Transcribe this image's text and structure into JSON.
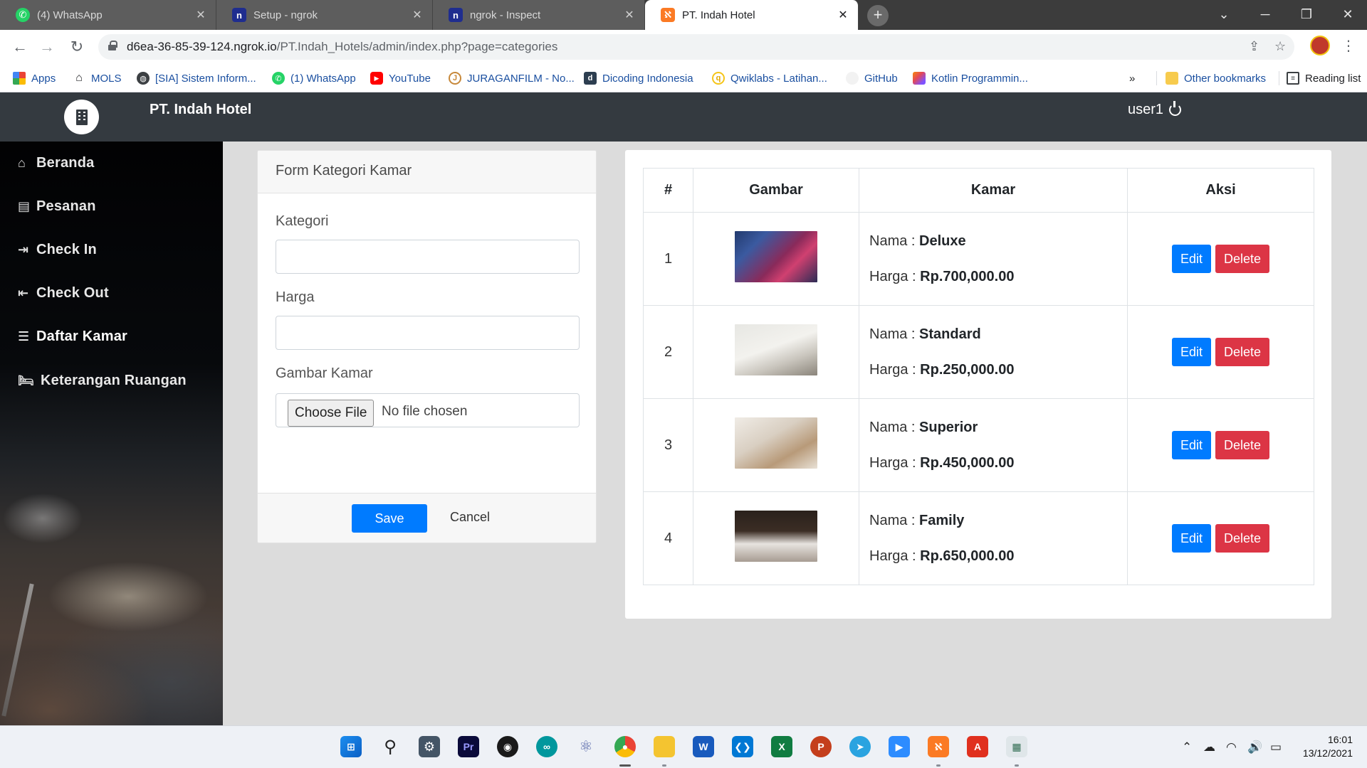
{
  "browser": {
    "tabs": [
      {
        "title": "(4) WhatsApp",
        "favicon": "whatsapp-icon",
        "color": "#25d366"
      },
      {
        "title": "Setup - ngrok",
        "favicon": "ngrok-icon",
        "color": "#1f2d8f"
      },
      {
        "title": "ngrok - Inspect",
        "favicon": "ngrok-icon",
        "color": "#1f2d8f"
      },
      {
        "title": "PT. Indah Hotel",
        "favicon": "xampp-icon",
        "color": "#fb7a24",
        "active": true
      }
    ],
    "url_host": "d6ea-36-85-39-124.ngrok.io",
    "url_path": "/PT.Indah_Hotels/admin/index.php?page=categories",
    "bookmarks": [
      {
        "label": "Apps",
        "icon": "apps-grid-icon"
      },
      {
        "label": "MOLS",
        "icon": "home-icon"
      },
      {
        "label": "[SIA] Sistem Inform...",
        "icon": "globe-icon"
      },
      {
        "label": "(1) WhatsApp",
        "icon": "whatsapp-icon"
      },
      {
        "label": "YouTube",
        "icon": "youtube-icon"
      },
      {
        "label": "JURAGANFILM - No...",
        "icon": "juraganfilm-icon"
      },
      {
        "label": "Dicoding Indonesia",
        "icon": "dicoding-icon"
      },
      {
        "label": "Qwiklabs - Latihan...",
        "icon": "qwiklabs-icon"
      },
      {
        "label": "GitHub",
        "icon": "github-icon"
      },
      {
        "label": "Kotlin Programmin...",
        "icon": "kotlin-icon"
      }
    ],
    "more": "»",
    "other_bookmarks": "Other bookmarks",
    "reading_list": "Reading list"
  },
  "header": {
    "brand": "PT. Indah Hotel",
    "user": "user1"
  },
  "sidebar": {
    "items": [
      {
        "label": "Beranda",
        "icon": "home-icon"
      },
      {
        "label": "Pesanan",
        "icon": "order-icon"
      },
      {
        "label": "Check In",
        "icon": "sign-in-icon"
      },
      {
        "label": "Check Out",
        "icon": "sign-out-icon"
      },
      {
        "label": "Daftar Kamar",
        "icon": "list-icon",
        "active": true
      },
      {
        "label": "Keterangan Ruangan",
        "icon": "bed-icon"
      }
    ]
  },
  "form": {
    "title": "Form Kategori Kamar",
    "kategori_label": "Kategori",
    "kategori_value": "",
    "harga_label": "Harga",
    "harga_value": "",
    "gambar_label": "Gambar Kamar",
    "file_button": "Choose File",
    "file_status": "No file chosen",
    "save": "Save",
    "cancel": "Cancel"
  },
  "table": {
    "headers": [
      "#",
      "Gambar",
      "Kamar",
      "Aksi"
    ],
    "nama_label": "Nama :",
    "harga_label": "Harga :",
    "edit": "Edit",
    "delete": "Delete",
    "rows": [
      {
        "no": "1",
        "nama": "Deluxe",
        "harga": "Rp.700,000.00"
      },
      {
        "no": "2",
        "nama": "Standard",
        "harga": "Rp.250,000.00"
      },
      {
        "no": "3",
        "nama": "Superior",
        "harga": "Rp.450,000.00"
      },
      {
        "no": "4",
        "nama": "Family",
        "harga": "Rp.650,000.00"
      }
    ]
  },
  "taskbar": {
    "time": "16:01",
    "date": "13/12/2021"
  },
  "colors": {
    "header_bg": "#343a40",
    "primary": "#007bff",
    "danger": "#dc3545"
  }
}
